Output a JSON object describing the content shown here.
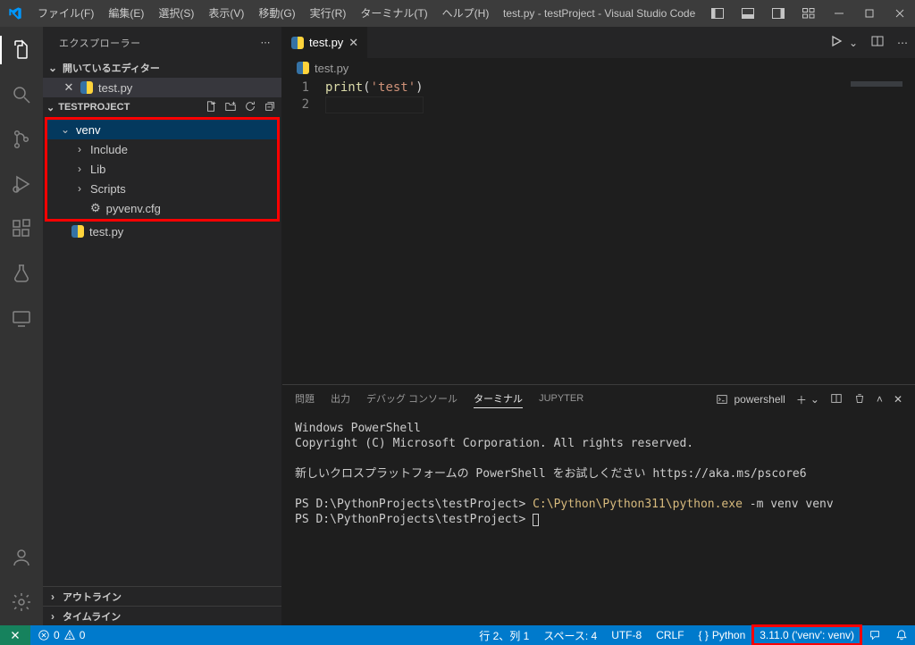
{
  "titlebar": {
    "menu": {
      "file": "ファイル(F)",
      "edit": "編集(E)",
      "selection": "選択(S)",
      "view": "表示(V)",
      "go": "移動(G)",
      "run": "実行(R)",
      "terminal": "ターミナル(T)",
      "help": "ヘルプ(H)"
    },
    "title": "test.py - testProject - Visual Studio Code"
  },
  "sidepanel": {
    "header": "エクスプローラー",
    "open_editors_header": "開いているエディター",
    "open_editors": {
      "file": "test.py"
    },
    "folder_header": "TESTPROJECT",
    "tree": {
      "venv": "venv",
      "include": "Include",
      "lib": "Lib",
      "scripts": "Scripts",
      "pyvenv": "pyvenv.cfg",
      "testpy": "test.py"
    },
    "outline": "アウトライン",
    "timeline": "タイムライン"
  },
  "tabs": {
    "testpy": "test.py"
  },
  "breadcrumbs": {
    "testpy": "test.py"
  },
  "editor": {
    "line1": {
      "fn": "print",
      "open": "(",
      "str": "'test'",
      "close": ")"
    }
  },
  "panel": {
    "tabs": {
      "problems": "問題",
      "output": "出力",
      "debug": "デバッグ コンソール",
      "terminal": "ターミナル",
      "jupyter": "JUPYTER"
    },
    "shell": "powershell",
    "terminal_lines": {
      "l1": "Windows PowerShell",
      "l2": "Copyright (C) Microsoft Corporation. All rights reserved.",
      "l3": "新しいクロスプラットフォームの PowerShell をお試しください https://aka.ms/pscore6",
      "prompt1_pre": "PS D:\\PythonProjects\\testProject> ",
      "prompt1_cmd": "C:\\Python\\Python311\\python.exe",
      "prompt1_args": " -m venv venv",
      "prompt2_pre": "PS D:\\PythonProjects\\testProject> "
    }
  },
  "statusbar": {
    "errors": "0",
    "warnings": "0",
    "line_col": "行 2、列 1",
    "spaces": "スペース: 4",
    "encoding": "UTF-8",
    "eol": "CRLF",
    "language": "Python",
    "interpreter": "3.11.0 ('venv': venv)"
  }
}
